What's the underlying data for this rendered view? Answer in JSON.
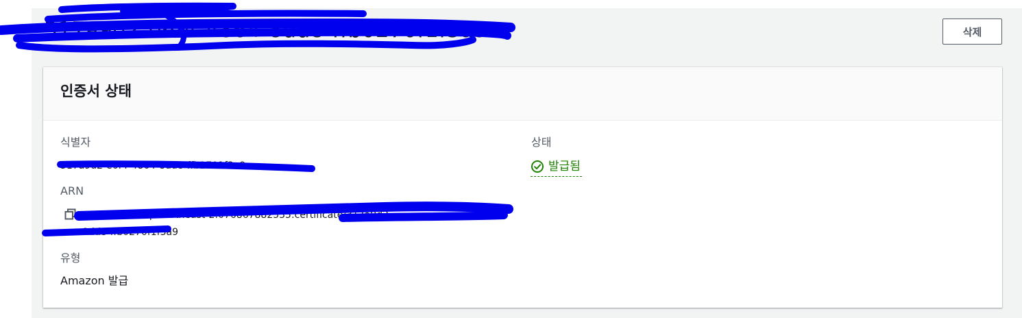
{
  "header": {
    "title": "317a9d2-e6f4-4864-8dd8-ffb0270f1f3a9",
    "delete_label": "삭제"
  },
  "panel": {
    "title": "인증서 상태",
    "identifier_label": "식별자",
    "identifier_value": "317a9d2-e6f4-4864-8dd8-ffb2701f3a9",
    "arn_label": "ARN",
    "arn_line1": "arn:aws:acm:ap-northeast-2:076867882535:certificate/317a9d2",
    "arn_line2": "-8dd8-ffb0270f1f3a9",
    "type_label": "유형",
    "type_value": "Amazon 발급",
    "status_label": "상태",
    "status_value": "발급됨"
  },
  "icons": {
    "copy": "copy-icon",
    "status": "check-circle-icon"
  },
  "colors": {
    "success": "#1d8102",
    "redaction": "#0000ee",
    "page_background": "#f2f3f3"
  }
}
